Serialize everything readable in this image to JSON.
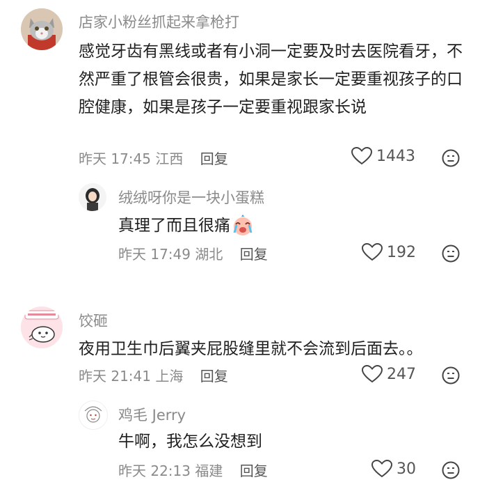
{
  "comments": [
    {
      "author": "店家小粉丝抓起来拿枪打",
      "text": "感觉牙齿有黑线或者有小洞一定要及时去医院看牙，不然严重了根管会很贵，如果是家长一定要重视孩子的口腔健康，如果是孩子一定要重视跟家长说",
      "time": "昨天 17:45",
      "location": "江西",
      "reply_label": "回复",
      "likes": "1443",
      "avatar_icon": "cat-avatar",
      "replies": [
        {
          "author": "绒绒呀你是一块小蛋糕",
          "text": "真理了而且很痛",
          "emoji": "crying-face-emoji",
          "time": "昨天 17:49",
          "location": "湖北",
          "reply_label": "回复",
          "likes": "192",
          "avatar_icon": "girl-avatar"
        }
      ]
    },
    {
      "author": "饺砸",
      "text": "夜用卫生巾后翼夹屁股缝里就不会流到后面去。。",
      "time": "昨天 21:41",
      "location": "上海",
      "reply_label": "回复",
      "likes": "247",
      "avatar_icon": "cartoon-sticker-avatar",
      "replies": [
        {
          "author": "鸡毛 Jerry",
          "text": "牛啊，我怎么没想到",
          "time": "昨天 22:13",
          "location": "福建",
          "reply_label": "回复",
          "likes": "30",
          "avatar_icon": "sketch-avatar"
        }
      ]
    }
  ]
}
